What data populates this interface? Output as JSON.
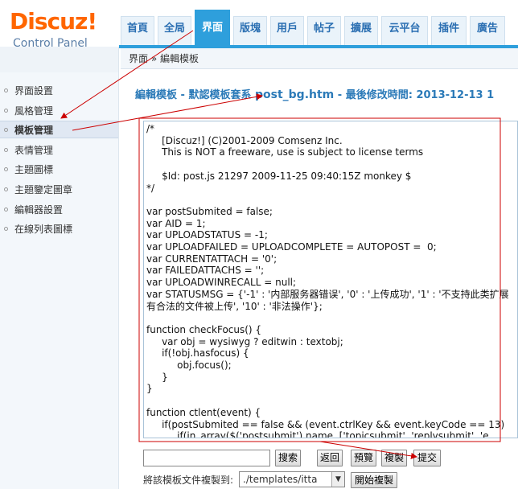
{
  "logo": {
    "main": "Discuz!",
    "sub": "Control Panel"
  },
  "nav": {
    "tabs": [
      {
        "label": "首頁"
      },
      {
        "label": "全局"
      },
      {
        "label": "界面",
        "active": true
      },
      {
        "label": "版塊"
      },
      {
        "label": "用戶"
      },
      {
        "label": "帖子"
      },
      {
        "label": "擴展"
      },
      {
        "label": "云平台"
      },
      {
        "label": "插件"
      },
      {
        "label": "廣告"
      }
    ]
  },
  "breadcrumb": "界面 » 編輯模板",
  "sidebar": {
    "items": [
      {
        "label": "界面設置"
      },
      {
        "label": "風格管理"
      },
      {
        "label": "模板管理",
        "active": true
      },
      {
        "label": "表情管理"
      },
      {
        "label": "主題圖標"
      },
      {
        "label": "主題鑒定圖章"
      },
      {
        "label": "編輯器設置"
      },
      {
        "label": "在線列表圖標"
      }
    ]
  },
  "title": {
    "prefix": "編輯模板 - 默認模板套系 ",
    "file": "post_bg.htm",
    "suffix": " - 最後修改時間: 2013-12-13 1"
  },
  "editor": {
    "content": "/*\n\t[Discuz!] (C)2001-2009 Comsenz Inc.\n\tThis is NOT a freeware, use is subject to license terms\n\n\t$Id: post.js 21297 2009-11-25 09:40:15Z monkey $\n*/\n\nvar postSubmited = false;\nvar AID = 1;\nvar UPLOADSTATUS = -1;\nvar UPLOADFAILED = UPLOADCOMPLETE = AUTOPOST =  0;\nvar CURRENTATTACH = '0';\nvar FAILEDATTACHS = '';\nvar UPLOADWINRECALL = null;\nvar STATUSMSG = {'-1' : '内部服务器错误', '0' : '上传成功', '1' : '不支持此类扩展\n有合法的文件被上传', '10' : '非法操作'};\n\nfunction checkFocus() {\n\tvar obj = wysiwyg ? editwin : textobj;\n\tif(!obj.hasfocus) {\n\t\tobj.focus();\n\t}\n}\n\nfunction ctlent(event) {\n\tif(postSubmited == false && (event.ctrlKey && event.keyCode == 13)\n\t\tif(in_array($('postsubmit').name, ['topicsubmit', 'replysubmit', 'e"
  },
  "controls": {
    "search_value": "",
    "search_label": "搜索",
    "back_label": "返回",
    "preview_label": "預覽",
    "copy_label": "複製",
    "submit_label": "提交",
    "copy_to_label": "將該模板文件複製到:",
    "dir_value": "./templates/itta",
    "start_copy_label": "開始複製"
  },
  "annotation_color": "#cc0000"
}
